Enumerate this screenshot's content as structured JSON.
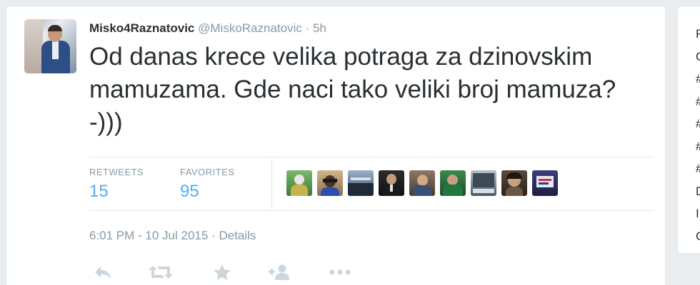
{
  "tweet": {
    "display_name": "Misko4Raznatovic",
    "screen_name": "@MiskoRaznatovic",
    "separator": "·",
    "time_ago": "5h",
    "text": "Od danas krece velika potraga za dzinovskim mamuzama. Gde naci tako veliki broj mamuza? -)))",
    "timestamp": "6:01 PM - 10 Jul 2015",
    "details_separator": "·",
    "details_label": "Details"
  },
  "stats": {
    "retweets_label": "RETWEETS",
    "retweets_value": "15",
    "favorites_label": "FAVORITES",
    "favorites_value": "95"
  },
  "favoriters_count": 9,
  "actions": [
    "reply-icon",
    "retweet-icon",
    "favorite-icon",
    "follow-icon",
    "more-icon"
  ],
  "sidebar_partial": [
    "F",
    "C",
    "#",
    "#",
    "#",
    "#",
    "#",
    "D",
    "I",
    "C"
  ],
  "colors": {
    "link": "#55acee",
    "text": "#292f33",
    "muted": "#8899a6",
    "icon": "#ccd6dd",
    "border": "#e1e8ed",
    "page_bg": "#e9edf0"
  }
}
